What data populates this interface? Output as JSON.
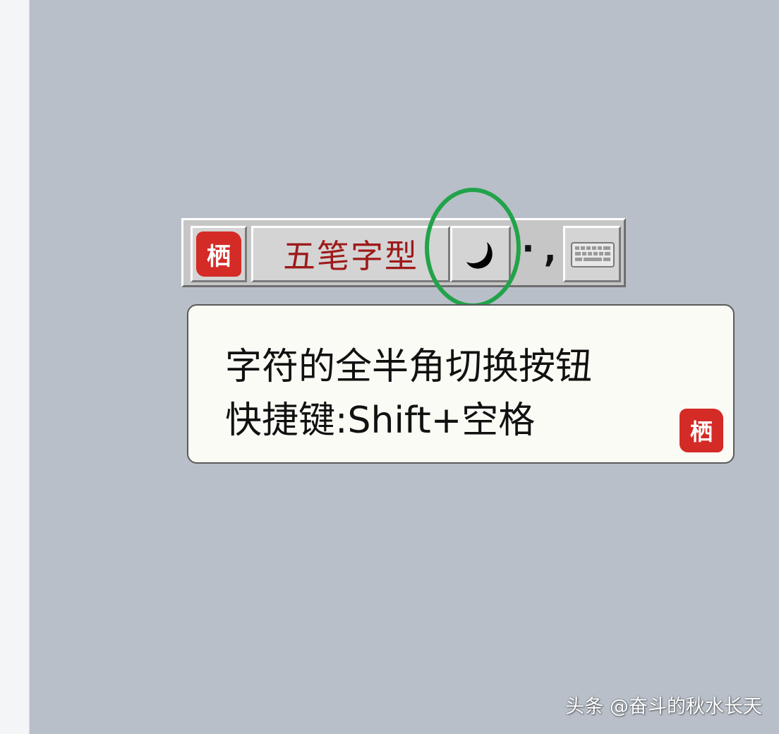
{
  "ime_bar": {
    "logo_glyph": "栖",
    "name": "五笔字型",
    "shape_icon": "half-width-moon-icon",
    "punct_glyph": "·,",
    "keyboard_icon": "keyboard-icon"
  },
  "tooltip": {
    "line1": "字符的全半角切换按钮",
    "line2": "快捷键:Shift+空格",
    "seal_glyph": "栖"
  },
  "highlight": {
    "color": "#22a34a"
  },
  "watermark": "头条 @奋斗的秋水长天",
  "colors": {
    "background": "#b8bfc9",
    "seal": "#d42b26",
    "ime_name": "#9e1a1a"
  }
}
